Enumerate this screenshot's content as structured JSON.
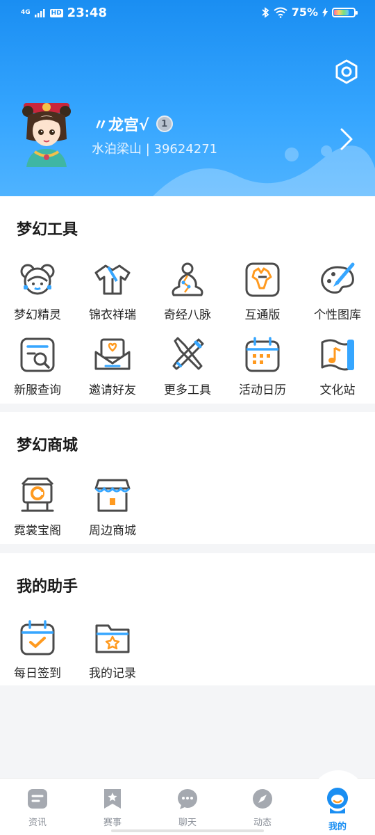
{
  "status_bar": {
    "network": "4G",
    "hd": "HD",
    "time": "23:48",
    "battery": "75%"
  },
  "profile": {
    "name": "〃龙宫√",
    "level": "1",
    "server_and_id": "水泊梁山 | 39624271"
  },
  "sections": {
    "tools": {
      "title": "梦幻工具",
      "items": [
        "梦幻精灵",
        "锦衣祥瑞",
        "奇经八脉",
        "互通版",
        "个性图库",
        "新服查询",
        "邀请好友",
        "更多工具",
        "活动日历",
        "文化站"
      ]
    },
    "mall": {
      "title": "梦幻商城",
      "items": [
        "霓裳宝阁",
        "周边商城"
      ]
    },
    "assistant": {
      "title": "我的助手",
      "items": [
        "每日签到",
        "我的记录"
      ]
    }
  },
  "bottom_nav": {
    "items": [
      "资讯",
      "赛事",
      "聊天",
      "动态",
      "我的"
    ],
    "active": "我的"
  },
  "colors": {
    "accent": "#1a8ef2",
    "icon_stroke": "#4a4a4a",
    "icon_highlight_orange": "#ff9a1f",
    "icon_highlight_blue": "#36a6ff"
  }
}
